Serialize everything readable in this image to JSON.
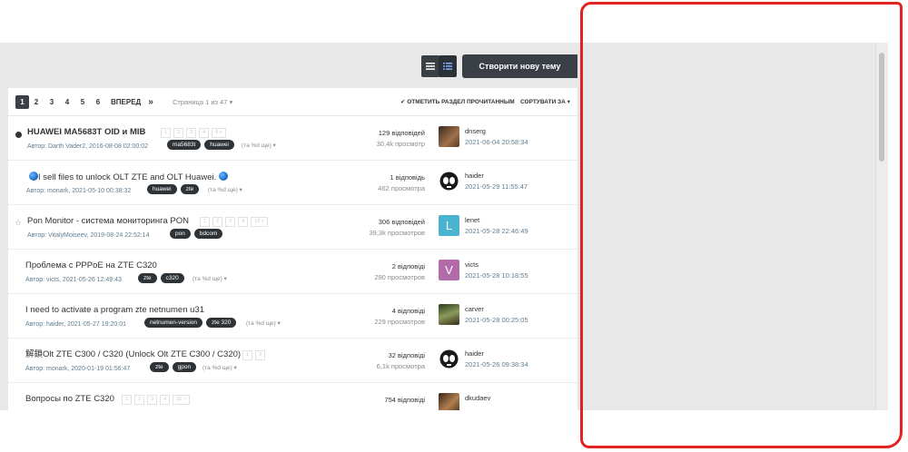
{
  "toolbar": {
    "create_topic_label": "Створити нову тему",
    "view_list_icon": "list-view-icon",
    "view_detail_icon": "detail-view-icon"
  },
  "pager": {
    "pages": [
      "1",
      "2",
      "3",
      "4",
      "5",
      "6"
    ],
    "next_label": "ВПЕРЕД",
    "last_label": "»",
    "page_info": "Страница 1 из 47 ▾",
    "mark_read_label": "✔ ОТМЕТИТЬ РАЗДЕЛ ПРОЧИТАННЫМ",
    "sort_label": "СОРТУВАТИ ЗА ▾"
  },
  "topics": [
    {
      "title": "HUAWEI MA5683T OID и MIB",
      "status": "dot",
      "bold": true,
      "minipages": [
        "1",
        "2",
        "3",
        "4",
        "6 »"
      ],
      "meta": "Автор: Darth Vader2, 2016-08-08 02:00:02",
      "tags": [
        "ma5683t",
        "huawei"
      ],
      "more_tags": "(та %d ще) ▾",
      "replies": "129 відповідей",
      "views": "30,4k просмотр",
      "last_user": "dnserg",
      "last_date": "2021-06-04 20:58:34",
      "avatar_color": "#7a4a2e",
      "avatar_letter": ""
    },
    {
      "title_prefix": "",
      "title": "I sell files to unlock OLT ZTE and OLT Huawei.",
      "status": "none",
      "bold": false,
      "minipages": [],
      "meta": "Автор: monark, 2021-05-10 00:38:32",
      "tags": [
        "huawei",
        "zte"
      ],
      "more_tags": "(та %d ще) ▾",
      "replies": "1 відповідь",
      "views": "462 просмотра",
      "last_user": "haider",
      "last_date": "2021-05-29 11:55:47",
      "avatar_color": "#222222",
      "avatar_letter": ""
    },
    {
      "title": "Pon Monitor - система мониторинга PON",
      "status": "star",
      "bold": false,
      "minipages": [
        "1",
        "2",
        "3",
        "4",
        "13 »"
      ],
      "meta": "Автор: VitalyMoiseev, 2019-08-24 22:52:14",
      "tags": [
        "pon",
        "bdcom"
      ],
      "more_tags": "",
      "replies": "306 відповідей",
      "views": "39,3k просмотров",
      "last_user": "lenet",
      "last_date": "2021-05-28 22:46:49",
      "avatar_color": "#4ab3cf",
      "avatar_letter": "L"
    },
    {
      "title": "Проблема с PPPoE на ZTE C320",
      "status": "none",
      "bold": false,
      "minipages": [],
      "meta": "Автор: victs, 2021-05-26 12:49:43",
      "tags": [
        "zte",
        "c320"
      ],
      "more_tags": "(та %d ще) ▾",
      "replies": "2 відповіді",
      "views": "290 просмотров",
      "last_user": "victs",
      "last_date": "2021-05-28 10:18:55",
      "avatar_color": "#b36aa8",
      "avatar_letter": "V"
    },
    {
      "title": "I need to activate a program zte netnumen u31",
      "status": "none",
      "bold": false,
      "minipages": [],
      "meta": "Автор: haider, 2021-05-27 19:20:01",
      "tags": [
        "netnumen-version",
        "zte 320"
      ],
      "more_tags": "(та %d ще) ▾",
      "replies": "4 відповіді",
      "views": "229 просмотров",
      "last_user": "carver",
      "last_date": "2021-05-28 00:25:05",
      "avatar_color": "#5a6b3a",
      "avatar_letter": ""
    },
    {
      "title": "解鎖Olt ZTE C300 / C320 (Unlock Olt ZTE C300 / C320)",
      "status": "none",
      "bold": false,
      "minipages": [
        "1",
        "2"
      ],
      "meta": "Автор: monark, 2020-01-19 01:56:47",
      "tags": [
        "zte",
        "gpon"
      ],
      "more_tags": "(та %d ще) ▾",
      "replies": "32 відповіді",
      "views": "6,1k просмотра",
      "last_user": "haider",
      "last_date": "2021-05-26 09:38:34",
      "avatar_color": "#222222",
      "avatar_letter": ""
    },
    {
      "title": "Вопросы по ZTE C320",
      "status": "none",
      "bold": false,
      "minipages": [
        "1",
        "2",
        "3",
        "4",
        "31 »"
      ],
      "meta": "",
      "tags": [],
      "more_tags": "",
      "replies": "754 відповіді",
      "views": "",
      "last_user": "dkudaev",
      "last_date": "",
      "avatar_color": "#6b4a2a",
      "avatar_letter": ""
    }
  ]
}
